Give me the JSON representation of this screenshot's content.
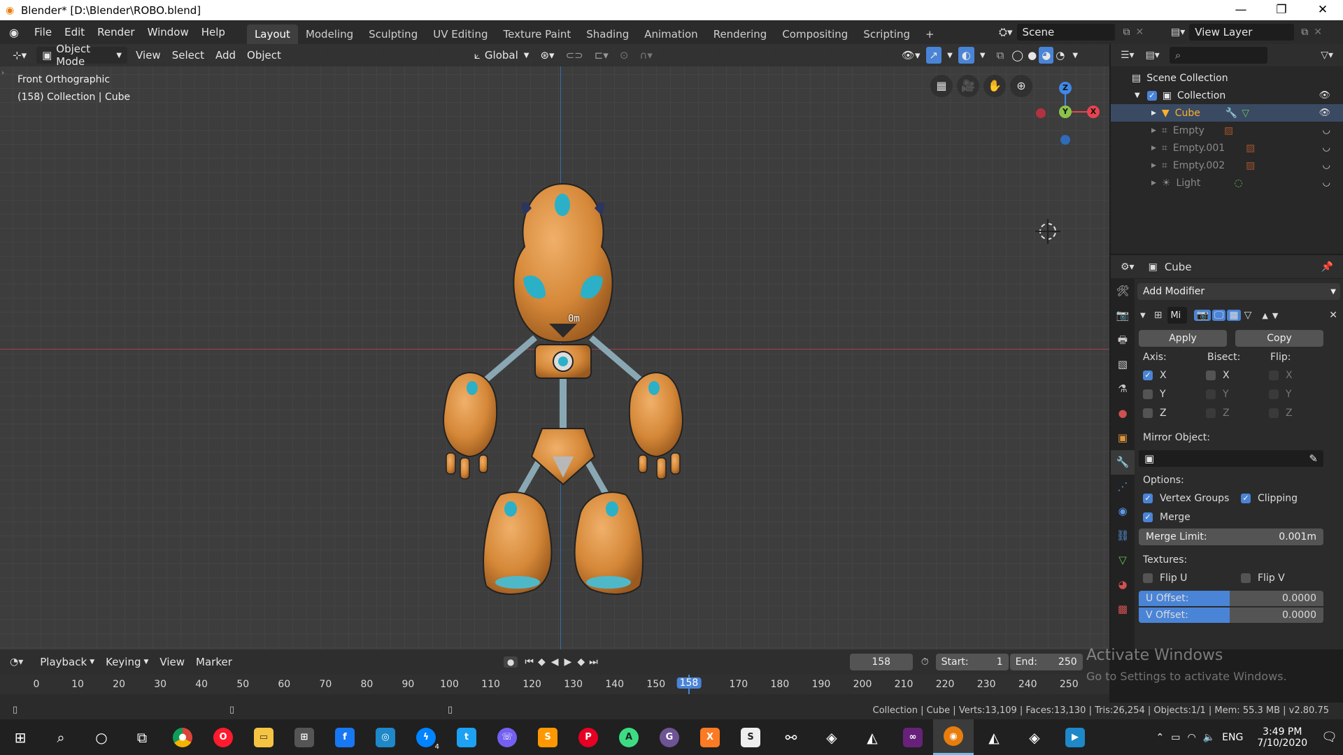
{
  "window": {
    "title": "Blender* [D:\\Blender\\ROBO.blend]",
    "minimize": "—",
    "maximize": "❐",
    "close": "✕"
  },
  "menu": [
    "File",
    "Edit",
    "Render",
    "Window",
    "Help"
  ],
  "workspaces": [
    "Layout",
    "Modeling",
    "Sculpting",
    "UV Editing",
    "Texture Paint",
    "Shading",
    "Animation",
    "Rendering",
    "Compositing",
    "Scripting"
  ],
  "workspace_add": "+",
  "scene": {
    "label": "Scene",
    "view_layer": "View Layer"
  },
  "viewport": {
    "mode": "Object Mode",
    "menus": [
      "View",
      "Select",
      "Add",
      "Object"
    ],
    "orientation": "Global",
    "info_line1": "Front Orthographic",
    "info_line2": "(158) Collection | Cube",
    "measure": "0m",
    "gizmo": {
      "z": "Z",
      "y": "Y",
      "x": "X"
    }
  },
  "outliner": {
    "root": "Scene Collection",
    "collection": "Collection",
    "items": [
      {
        "name": "Cube",
        "active": true
      },
      {
        "name": "Empty",
        "active": false
      },
      {
        "name": "Empty.001",
        "active": false
      },
      {
        "name": "Empty.002",
        "active": false
      },
      {
        "name": "Light",
        "active": false
      }
    ]
  },
  "properties": {
    "object": "Cube",
    "add_modifier": "Add Modifier",
    "modifier_name": "Mi",
    "apply": "Apply",
    "copy": "Copy",
    "axis_label": "Axis:",
    "bisect_label": "Bisect:",
    "flip_label": "Flip:",
    "axes": [
      "X",
      "Y",
      "Z"
    ],
    "mirror_object": "Mirror Object:",
    "options": "Options:",
    "vertex_groups": "Vertex Groups",
    "clipping": "Clipping",
    "merge": "Merge",
    "merge_limit_label": "Merge Limit:",
    "merge_limit": "0.001m",
    "textures": "Textures:",
    "flip_u": "Flip U",
    "flip_v": "Flip V",
    "u_offset_label": "U Offset:",
    "u_offset": "0.0000",
    "v_offset_label": "V Offset:",
    "v_offset": "0.0000"
  },
  "timeline": {
    "menus": [
      "Playback",
      "Keying",
      "View",
      "Marker"
    ],
    "current_frame": "158",
    "start_label": "Start:",
    "start": "1",
    "end_label": "End:",
    "end": "250",
    "ticks": [
      "0",
      "10",
      "20",
      "30",
      "40",
      "50",
      "60",
      "70",
      "80",
      "90",
      "100",
      "110",
      "120",
      "130",
      "140",
      "150",
      "158",
      "170",
      "180",
      "190",
      "200",
      "210",
      "220",
      "230",
      "240",
      "250"
    ]
  },
  "status": "Collection | Cube | Verts:13,109 | Faces:13,130 | Tris:26,254 | Objects:1/1 | Mem: 55.3 MB | v2.80.75",
  "watermark": {
    "line1": "Activate Windows",
    "line2": "Go to Settings to activate Windows."
  },
  "taskbar": {
    "time": "3:49 PM",
    "date": "7/10/2020",
    "lang": "ENG",
    "badge": "4"
  },
  "colors": {
    "accent": "#4a84d6",
    "active_obj": "#ffaf29",
    "x_axis": "#e8434f",
    "y_axis": "#8bc34a",
    "z_axis": "#3f88e8"
  }
}
